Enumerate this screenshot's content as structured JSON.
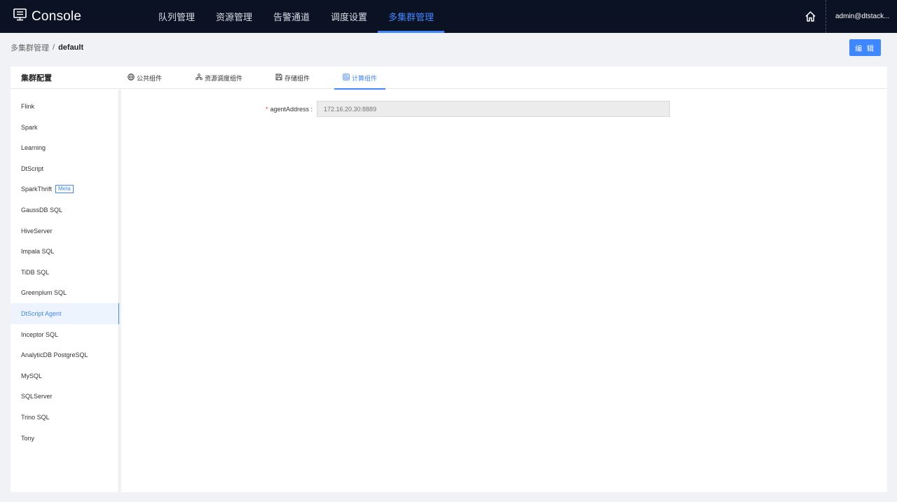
{
  "app": {
    "brand": "Console",
    "icon": "monitor-icon",
    "nav": [
      {
        "label": "队列管理",
        "active": false
      },
      {
        "label": "资源管理",
        "active": false
      },
      {
        "label": "告警通道",
        "active": false
      },
      {
        "label": "调度设置",
        "active": false
      },
      {
        "label": "多集群管理",
        "active": true
      }
    ],
    "home_icon": "home-icon",
    "user": "admin@dtstack..."
  },
  "breadcrumb": {
    "parent": "多集群管理",
    "separator": "/",
    "current": "default"
  },
  "actions": {
    "edit_label": "编 辑"
  },
  "panel": {
    "title": "集群配置",
    "tabs": [
      {
        "label": "公共组件",
        "icon": "globe-icon",
        "active": false
      },
      {
        "label": "资源调度组件",
        "icon": "cluster-icon",
        "active": false
      },
      {
        "label": "存储组件",
        "icon": "save-icon",
        "active": false
      },
      {
        "label": "计算组件",
        "icon": "calculator-icon",
        "active": true
      }
    ],
    "components": [
      {
        "label": "Flink"
      },
      {
        "label": "Spark"
      },
      {
        "label": "Learning"
      },
      {
        "label": "DtScript"
      },
      {
        "label": "SparkThrift",
        "badge": "Meta"
      },
      {
        "label": "GaussDB SQL"
      },
      {
        "label": "HiveServer"
      },
      {
        "label": "Impala SQL"
      },
      {
        "label": "TiDB SQL"
      },
      {
        "label": "Greenplum SQL"
      },
      {
        "label": "DtScript Agent",
        "active": true
      },
      {
        "label": "Inceptor SQL"
      },
      {
        "label": "AnalyticDB PostgreSQL"
      },
      {
        "label": "MySQL"
      },
      {
        "label": "SQLServer"
      },
      {
        "label": "Trino SQL"
      },
      {
        "label": "Tony"
      }
    ],
    "form": {
      "required_mark": "*",
      "label": "agentAddress :",
      "placeholder": "172.16.20.30:8889"
    }
  },
  "colors": {
    "topbar": "#0b1223",
    "accent": "#3f87ff",
    "required": "#f04134"
  }
}
